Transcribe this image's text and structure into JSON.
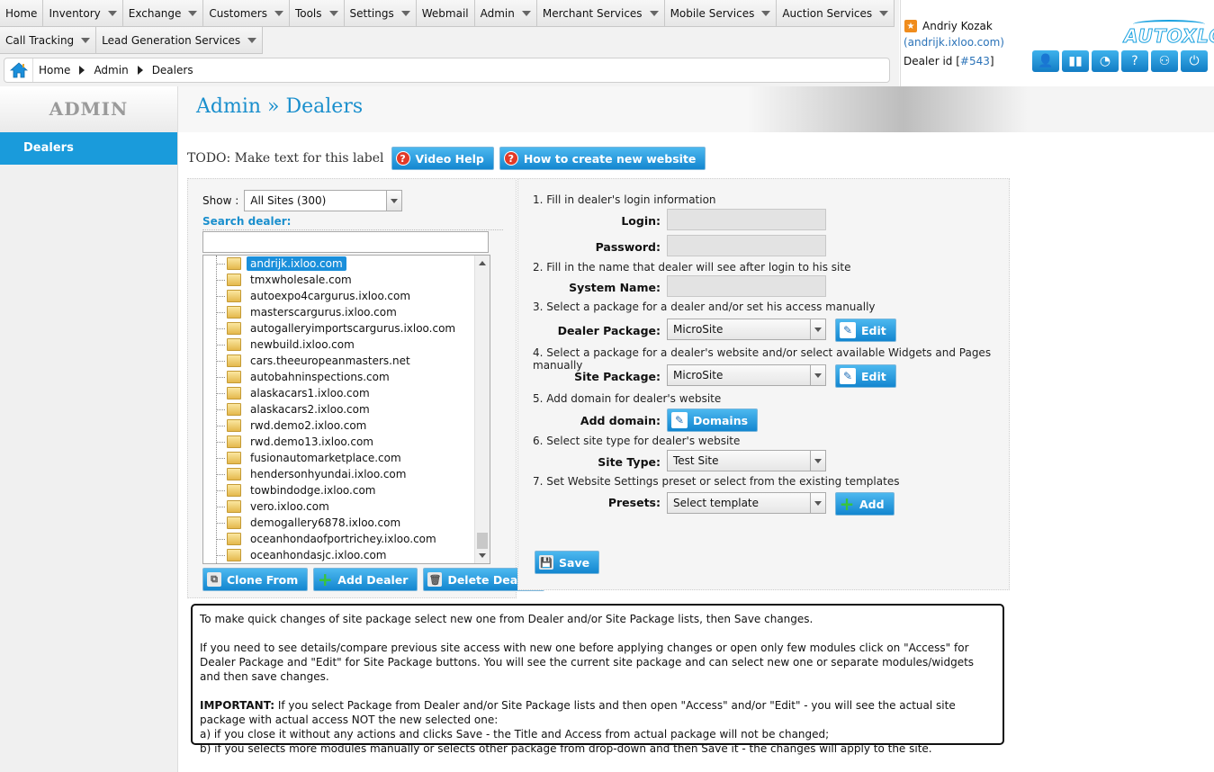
{
  "menu": {
    "row1": [
      "Home",
      "Inventory",
      "Exchange",
      "Customers",
      "Tools",
      "Settings",
      "Webmail",
      "Admin",
      "Merchant Services",
      "Mobile Services",
      "Auction Services"
    ],
    "row2": [
      "Call Tracking",
      "Lead Generation Services"
    ]
  },
  "breadcrumb": [
    "Home",
    "Admin",
    "Dealers"
  ],
  "user": {
    "name": "Andriy Kozak",
    "email": "(andrijk.ixloo.com)",
    "dealer_label": "Dealer id [",
    "dealer_id": "#543",
    "dealer_close": "]",
    "logo": "AUTOXLOO"
  },
  "sidebar": {
    "title": "ADMIN",
    "items": [
      "Dealers"
    ]
  },
  "page": {
    "title": "Admin » Dealers"
  },
  "todo": {
    "label": "TODO: Make text for this label",
    "video_help": "Video Help",
    "how_to": "How to create new website"
  },
  "left_panel": {
    "show_label": "Show :",
    "show_value": "All Sites (300)",
    "search_label": "Search dealer:",
    "dealers": [
      "andrijk.ixloo.com",
      "tmxwholesale.com",
      "autoexpo4cargurus.ixloo.com",
      "masterscargurus.ixloo.com",
      "autogalleryimportscargurus.ixloo.com",
      "newbuild.ixloo.com",
      "cars.theeuropeanmasters.net",
      "autobahninspections.com",
      "alaskacars1.ixloo.com",
      "alaskacars2.ixloo.com",
      "rwd.demo2.ixloo.com",
      "rwd.demo13.ixloo.com",
      "fusionautomarketplace.com",
      "hendersonhyundai.ixloo.com",
      "towbindodge.ixloo.com",
      "vero.ixloo.com",
      "demogallery6878.ixloo.com",
      "oceanhondaofportrichey.ixloo.com",
      "oceanhondasjc.ixloo.com"
    ],
    "selected_index": 0,
    "buttons": {
      "clone": "Clone From",
      "add": "Add Dealer",
      "delete": "Delete Dealer"
    }
  },
  "form": {
    "step1": "1. Fill in dealer's login information",
    "login_label": "Login:",
    "password_label": "Password:",
    "step2": "2. Fill in the name that dealer will see after login to his site",
    "system_name_label": "System Name:",
    "step3": "3. Select a package for a dealer and/or set his access manually",
    "dealer_package_label": "Dealer Package:",
    "dealer_package_value": "MicroSite",
    "edit_label": "Edit",
    "step4": "4. Select a package for a dealer's website and/or select available Widgets and Pages manually",
    "site_package_label": "Site Package:",
    "site_package_value": "MicroSite",
    "step5": "5. Add domain for dealer's website",
    "add_domain_label": "Add domain:",
    "domains_button": "Domains",
    "step6": "6. Select site type for dealer's website",
    "site_type_label": "Site Type:",
    "site_type_value": "Test Site",
    "step7": "7. Set Website Settings preset or select from the existing templates",
    "presets_label": "Presets:",
    "presets_value": "Select template",
    "add_button": "Add",
    "save_button": "Save"
  },
  "info": {
    "p1": "To make quick changes of site package select new one from Dealer and/or Site Package lists, then Save changes.",
    "p2": "If you need to see details/compare previous site access with new one before applying changes or open only few modules click on \"Access\" for Dealer Package and \"Edit\" for Site Package buttons. You will see the current site package and can select new one or separate modules/widgets and then save changes.",
    "important": "IMPORTANT:",
    "p3": " If you select Package from Dealer and/or Site Package lists and then open \"Access\" and/or \"Edit\" - you will see the actual site package with actual access NOT the new selected one:",
    "p3a": "a) if you close it without any actions and clicks Save - the Title and Access from actual package will not be changed;",
    "p3b": "b) if you selects more modules manually or selects other package from drop-down and then Save it - the changes will apply to the site."
  }
}
